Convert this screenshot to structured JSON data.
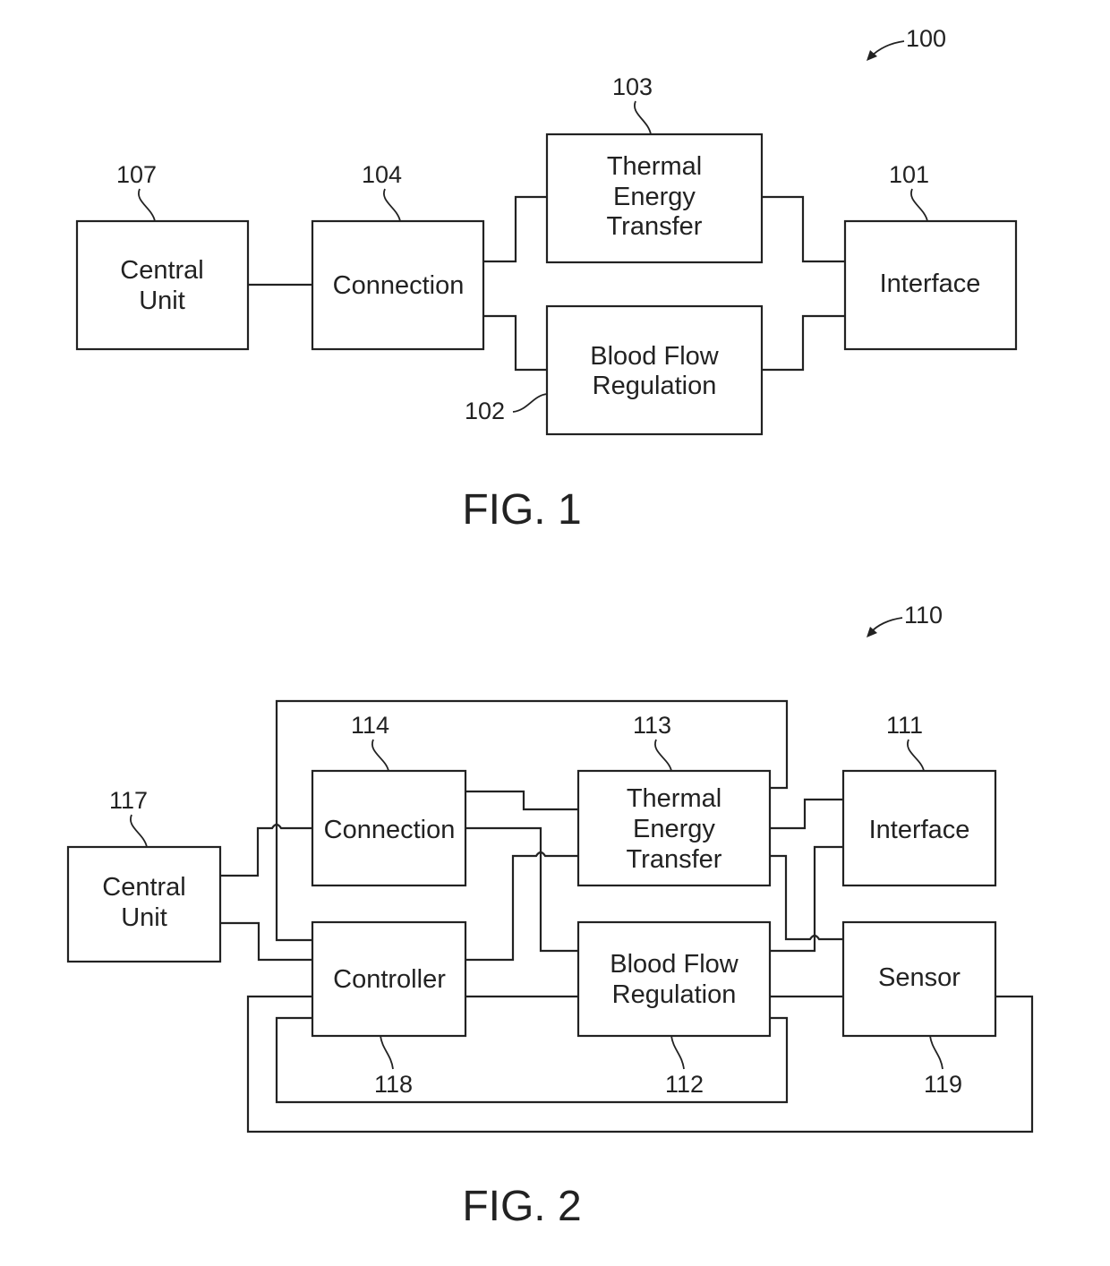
{
  "fig1": {
    "caption": "FIG. 1",
    "ref": "100",
    "blocks": {
      "central_unit": {
        "ref": "107",
        "lines": [
          "Central",
          "Unit"
        ]
      },
      "connection": {
        "ref": "104",
        "lines": [
          "Connection"
        ]
      },
      "thermal": {
        "ref": "103",
        "lines": [
          "Thermal",
          "Energy",
          "Transfer"
        ]
      },
      "blood_flow": {
        "ref": "102",
        "lines": [
          "Blood Flow",
          "Regulation"
        ]
      },
      "interface": {
        "ref": "101",
        "lines": [
          "Interface"
        ]
      }
    }
  },
  "fig2": {
    "caption": "FIG. 2",
    "ref": "110",
    "blocks": {
      "central_unit": {
        "ref": "117",
        "lines": [
          "Central",
          "Unit"
        ]
      },
      "connection": {
        "ref": "114",
        "lines": [
          "Connection"
        ]
      },
      "thermal": {
        "ref": "113",
        "lines": [
          "Thermal",
          "Energy",
          "Transfer"
        ]
      },
      "interface": {
        "ref": "111",
        "lines": [
          "Interface"
        ]
      },
      "controller": {
        "ref": "118",
        "lines": [
          "Controller"
        ]
      },
      "blood_flow": {
        "ref": "112",
        "lines": [
          "Blood Flow",
          "Regulation"
        ]
      },
      "sensor": {
        "ref": "119",
        "lines": [
          "Sensor"
        ]
      }
    }
  }
}
